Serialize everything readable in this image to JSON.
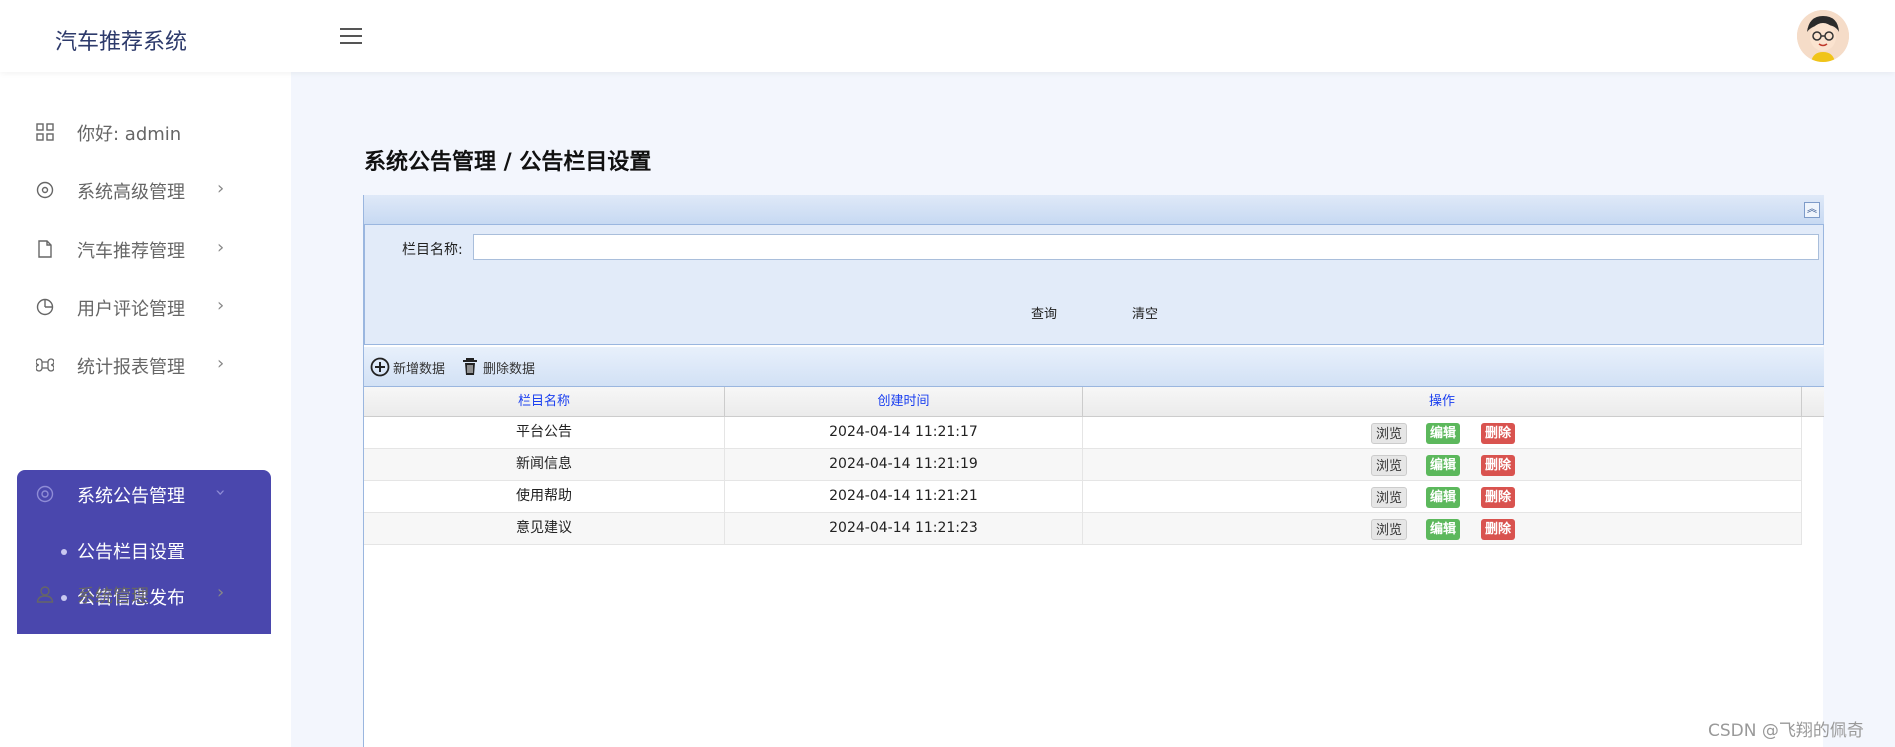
{
  "header": {
    "brand": "汽车推荐系统"
  },
  "sidebar": {
    "greeting": "你好: admin",
    "items": [
      {
        "label": "系统高级管理"
      },
      {
        "label": "汽车推荐管理"
      },
      {
        "label": "用户评论管理"
      },
      {
        "label": "统计报表管理"
      },
      {
        "label": "系统公告管理"
      },
      {
        "label": "系统管理"
      }
    ],
    "sub_items": [
      {
        "label": "公告栏目设置"
      },
      {
        "label": "公告信息发布"
      }
    ]
  },
  "main": {
    "title": "系统公告管理 / 公告栏目设置",
    "search": {
      "label": "栏目名称:",
      "value": "",
      "query_button": "查询",
      "clear_button": "清空"
    },
    "toolbar": {
      "add_label": "新增数据",
      "delete_label": "删除数据"
    },
    "table": {
      "headers": [
        "栏目名称",
        "创建时间",
        "操作"
      ],
      "rows": [
        {
          "name": "平台公告",
          "created": "2024-04-14 11:21:17"
        },
        {
          "name": "新闻信息",
          "created": "2024-04-14 11:21:19"
        },
        {
          "name": "使用帮助",
          "created": "2024-04-14 11:21:21"
        },
        {
          "name": "意见建议",
          "created": "2024-04-14 11:21:23"
        }
      ],
      "actions": {
        "view": "浏览",
        "edit": "编辑",
        "delete": "删除"
      }
    }
  },
  "watermark": "CSDN @飞翔的佩奇",
  "colors": {
    "sidebar_active": "#4a47ad",
    "edit": "#5cb85c",
    "delete": "#d9534f",
    "header_link": "#1a3ff0"
  }
}
